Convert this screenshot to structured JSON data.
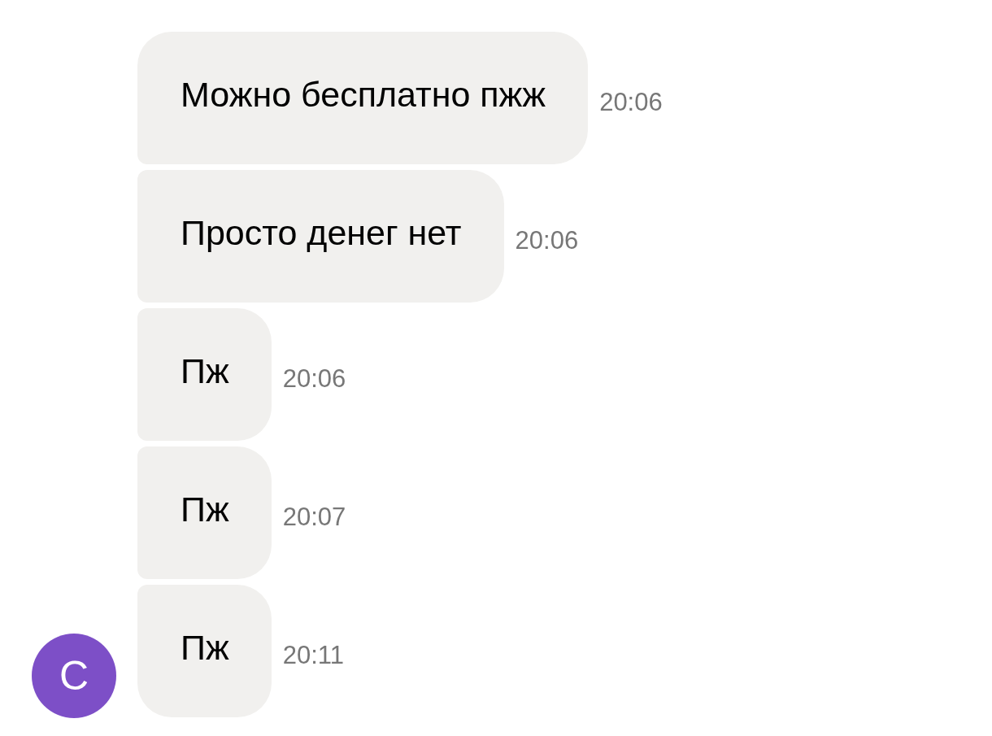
{
  "messages": [
    {
      "text": "Можно бесплатно пжж",
      "time": "20:06"
    },
    {
      "text": "Просто денег нет",
      "time": "20:06"
    },
    {
      "text": "Пж",
      "time": "20:06"
    },
    {
      "text": "Пж",
      "time": "20:07"
    },
    {
      "text": "Пж",
      "time": "20:11"
    }
  ],
  "avatar": {
    "letter": "С",
    "color": "#7d4fc7"
  }
}
